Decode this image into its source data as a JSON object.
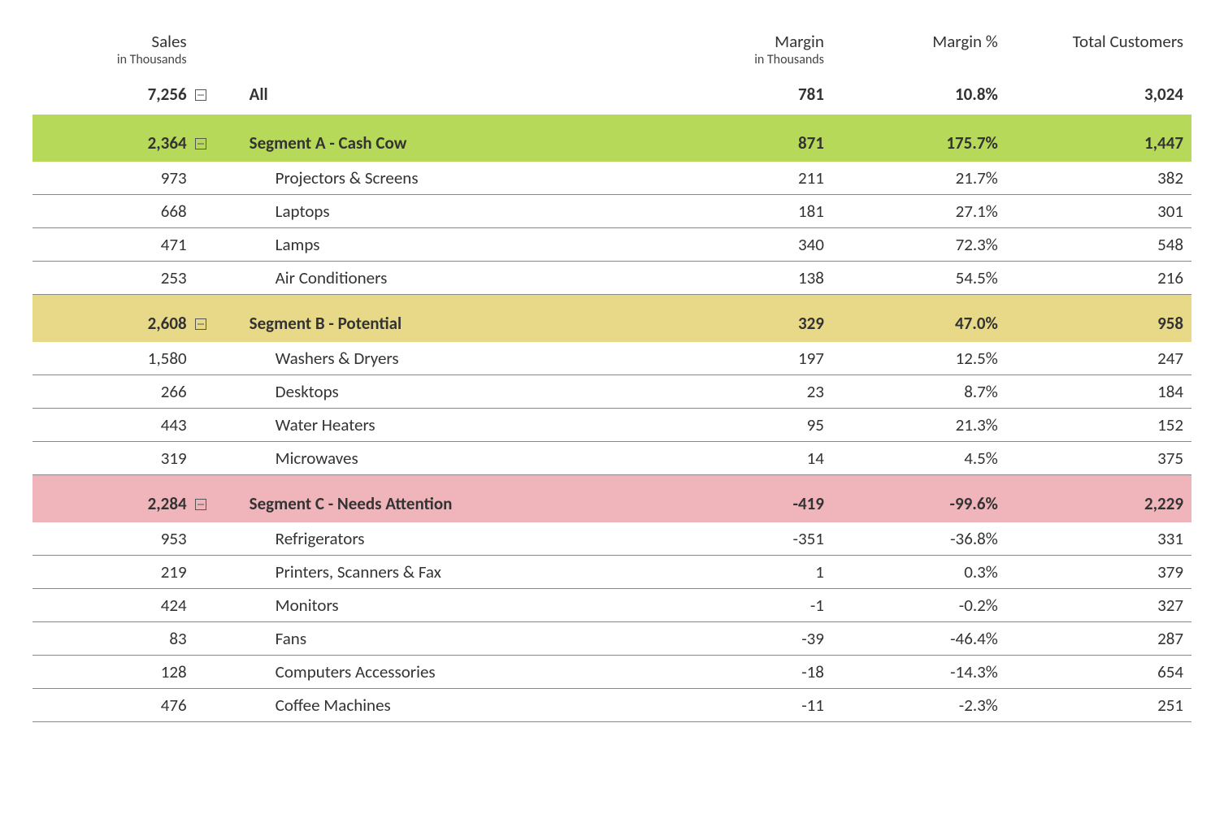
{
  "headers": {
    "sales_title": "Sales",
    "sales_sub": "in Thousands",
    "margin_title": "Margin",
    "margin_sub": "in Thousands",
    "margin_pct_title": "Margin %",
    "customers_title": "Total Customers"
  },
  "all": {
    "label": "All",
    "sales": "7,256",
    "margin": "781",
    "margin_pct": "10.8%",
    "customers": "3,024"
  },
  "segments": [
    {
      "key": "a",
      "label": "Segment A - Cash Cow",
      "sales": "2,364",
      "margin": "871",
      "margin_pct": "175.7%",
      "customers": "1,447",
      "items": [
        {
          "label": "Projectors & Screens",
          "sales": "973",
          "margin": "211",
          "margin_pct": "21.7%",
          "customers": "382"
        },
        {
          "label": "Laptops",
          "sales": "668",
          "margin": "181",
          "margin_pct": "27.1%",
          "customers": "301"
        },
        {
          "label": "Lamps",
          "sales": "471",
          "margin": "340",
          "margin_pct": "72.3%",
          "customers": "548"
        },
        {
          "label": "Air Conditioners",
          "sales": "253",
          "margin": "138",
          "margin_pct": "54.5%",
          "customers": "216"
        }
      ]
    },
    {
      "key": "b",
      "label": "Segment B - Potential",
      "sales": "2,608",
      "margin": "329",
      "margin_pct": "47.0%",
      "customers": "958",
      "items": [
        {
          "label": "Washers & Dryers",
          "sales": "1,580",
          "margin": "197",
          "margin_pct": "12.5%",
          "customers": "247"
        },
        {
          "label": "Desktops",
          "sales": "266",
          "margin": "23",
          "margin_pct": "8.7%",
          "customers": "184"
        },
        {
          "label": "Water Heaters",
          "sales": "443",
          "margin": "95",
          "margin_pct": "21.3%",
          "customers": "152"
        },
        {
          "label": "Microwaves",
          "sales": "319",
          "margin": "14",
          "margin_pct": "4.5%",
          "customers": "375"
        }
      ]
    },
    {
      "key": "c",
      "label": "Segment C - Needs Attention",
      "sales": "2,284",
      "margin": "-419",
      "margin_pct": "-99.6%",
      "customers": "2,229",
      "items": [
        {
          "label": "Refrigerators",
          "sales": "953",
          "margin": "-351",
          "margin_pct": "-36.8%",
          "customers": "331"
        },
        {
          "label": "Printers, Scanners & Fax",
          "sales": "219",
          "margin": "1",
          "margin_pct": "0.3%",
          "customers": "379"
        },
        {
          "label": "Monitors",
          "sales": "424",
          "margin": "-1",
          "margin_pct": "-0.2%",
          "customers": "327"
        },
        {
          "label": "Fans",
          "sales": "83",
          "margin": "-39",
          "margin_pct": "-46.4%",
          "customers": "287"
        },
        {
          "label": "Computers Accessories",
          "sales": "128",
          "margin": "-18",
          "margin_pct": "-14.3%",
          "customers": "654"
        },
        {
          "label": "Coffee Machines",
          "sales": "476",
          "margin": "-11",
          "margin_pct": "-2.3%",
          "customers": "251"
        }
      ]
    }
  ]
}
